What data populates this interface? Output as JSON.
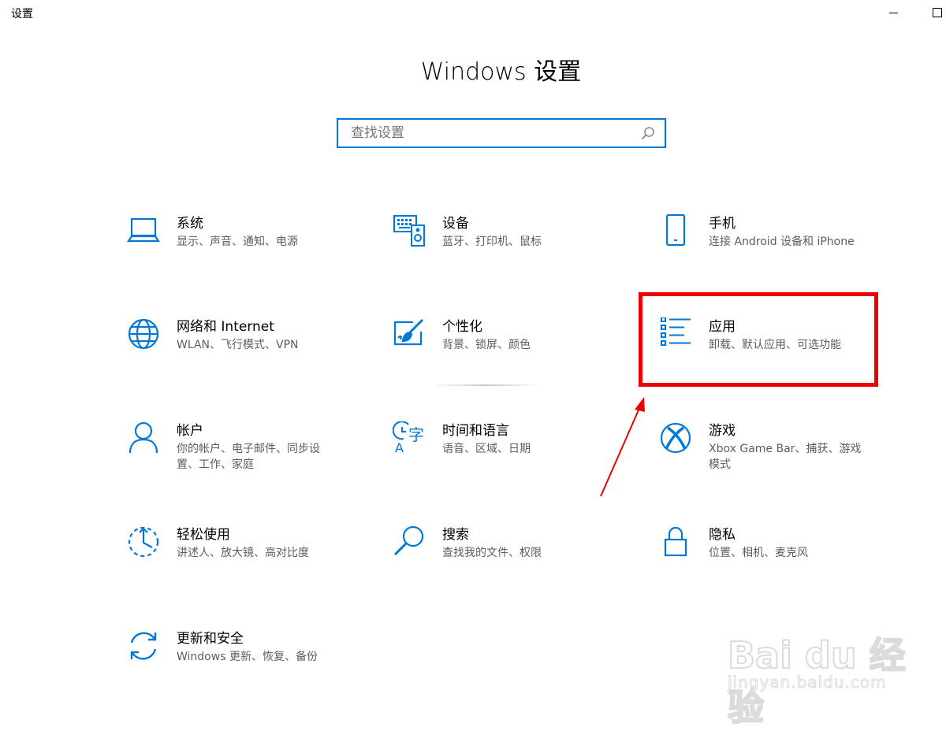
{
  "window": {
    "title": "设置"
  },
  "header": {
    "title": "Windows 设置"
  },
  "search": {
    "placeholder": "查找设置"
  },
  "tiles": [
    {
      "name": "系统",
      "desc": "显示、声音、通知、电源",
      "icon": "laptop-icon"
    },
    {
      "name": "设备",
      "desc": "蓝牙、打印机、鼠标",
      "icon": "devices-icon"
    },
    {
      "name": "手机",
      "desc": "连接 Android 设备和 iPhone",
      "icon": "phone-icon"
    },
    {
      "name": "网络和 Internet",
      "desc": "WLAN、飞行模式、VPN",
      "icon": "globe-icon"
    },
    {
      "name": "个性化",
      "desc": "背景、锁屏、颜色",
      "icon": "personalization-icon"
    },
    {
      "name": "应用",
      "desc": "卸载、默认应用、可选功能",
      "icon": "apps-list-icon"
    },
    {
      "name": "帐户",
      "desc": "你的帐户、电子邮件、同步设置、工作、家庭",
      "icon": "person-icon"
    },
    {
      "name": "时间和语言",
      "desc": "语音、区域、日期",
      "icon": "time-language-icon"
    },
    {
      "name": "游戏",
      "desc": "Xbox Game Bar、捕获、游戏模式",
      "icon": "xbox-icon"
    },
    {
      "name": "轻松使用",
      "desc": "讲述人、放大镜、高对比度",
      "icon": "ease-of-access-icon"
    },
    {
      "name": "搜索",
      "desc": "查找我的文件、权限",
      "icon": "search-icon"
    },
    {
      "name": "隐私",
      "desc": "位置、相机、麦克风",
      "icon": "lock-icon"
    },
    {
      "name": "更新和安全",
      "desc": "Windows 更新、恢复、备份",
      "icon": "update-icon"
    }
  ],
  "annotation": {
    "highlight_color": "#ee0000"
  },
  "watermark": {
    "brand": "Bai du 经验",
    "url": "jingyan.baidu.com"
  },
  "colors": {
    "accent": "#0078d7",
    "description_text": "#5d5d5d"
  }
}
